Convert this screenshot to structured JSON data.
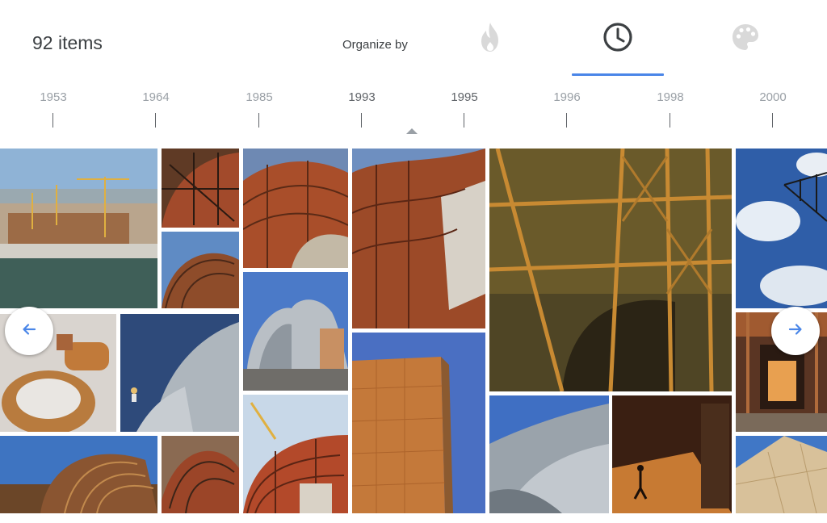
{
  "header": {
    "item_count": "92 items",
    "organize_label": "Organize by",
    "organize_options": [
      {
        "name": "popularity",
        "icon": "flame-icon",
        "selected": false
      },
      {
        "name": "time",
        "icon": "clock-icon",
        "selected": true
      },
      {
        "name": "color",
        "icon": "palette-icon",
        "selected": false
      }
    ],
    "accent_color": "#4a86e8"
  },
  "timeline": {
    "years": [
      "1953",
      "1964",
      "1985",
      "1993",
      "1995",
      "1996",
      "1998",
      "2000"
    ],
    "active_years": [
      "1993",
      "1995"
    ]
  },
  "gallery": {
    "tiles": [
      {
        "label": "Construction site aerial view by the river"
      },
      {
        "label": "Steel frame arches"
      },
      {
        "label": "Curved steel framework"
      },
      {
        "label": "Red steel lattice structure"
      },
      {
        "label": "Steel framework against sky"
      },
      {
        "label": "Illuminated steel framework at night"
      },
      {
        "label": "Sky with clouds and beam"
      },
      {
        "label": "Curved steel sculpture interior"
      },
      {
        "label": "Titanium facade with visitor"
      },
      {
        "label": "Titanium clad building"
      },
      {
        "label": "Interior construction corridor"
      },
      {
        "label": "Golden titanium panels against blue sky"
      },
      {
        "label": "Silver titanium curves"
      },
      {
        "label": "Silhouette worker at dusk"
      },
      {
        "label": "Steel framework closeup"
      },
      {
        "label": "Steel arches framework"
      },
      {
        "label": "Construction with crane"
      },
      {
        "label": "Golden facade detail"
      }
    ]
  },
  "navigation": {
    "prev_icon": "arrow-left-icon",
    "next_icon": "arrow-right-icon"
  }
}
